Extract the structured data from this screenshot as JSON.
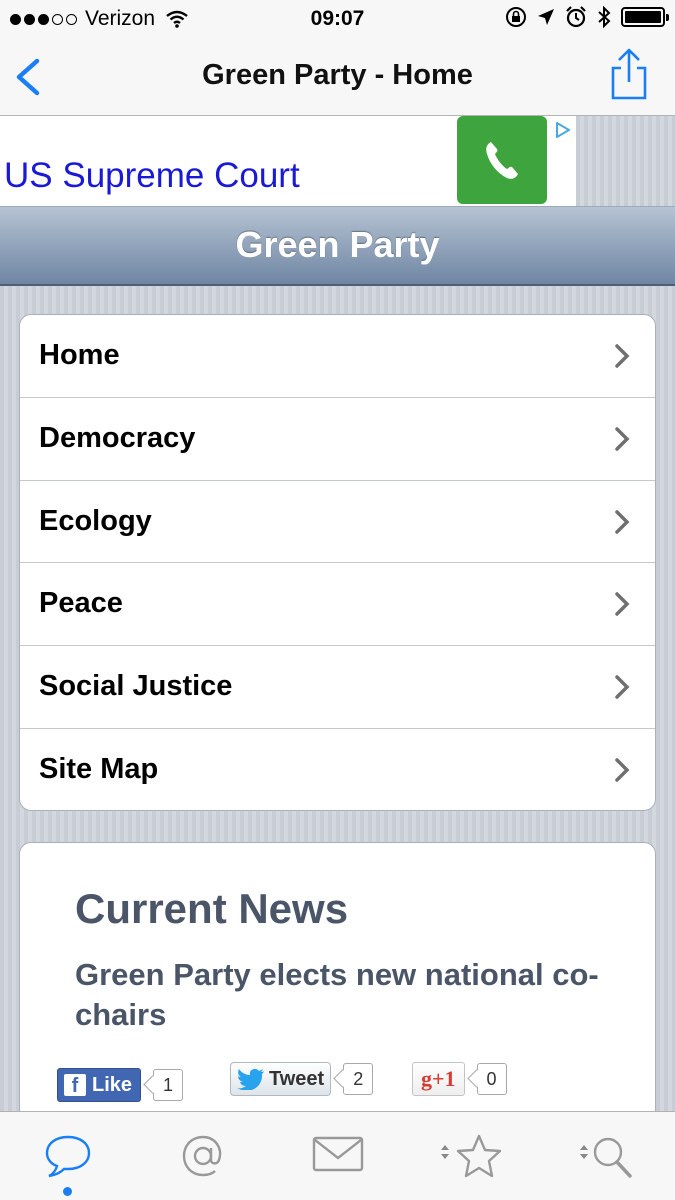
{
  "status_bar": {
    "carrier": "Verizon",
    "time": "09:07",
    "battery_percent": 100
  },
  "nav": {
    "title": "Green Party - Home"
  },
  "ad": {
    "text": "US Supreme Court"
  },
  "header": {
    "title": "Green Party"
  },
  "menu": {
    "items": [
      {
        "label": "Home"
      },
      {
        "label": "Democracy"
      },
      {
        "label": "Ecology"
      },
      {
        "label": "Peace"
      },
      {
        "label": "Social Justice"
      },
      {
        "label": "Site Map"
      }
    ]
  },
  "news": {
    "heading": "Current News",
    "headline": "Green Party elects new national co-chairs"
  },
  "social": {
    "like_label": "Like",
    "like_count": "1",
    "tweet_label": "Tweet",
    "tweet_count": "2",
    "gplus_label": "g+1",
    "gplus_count": "0"
  },
  "tabs": [
    "chat-icon",
    "at-icon",
    "mail-icon",
    "star-sort-icon",
    "search-sort-icon"
  ],
  "colors": {
    "accent": "#1a7ff5",
    "ad_link": "#1a1ad6",
    "call_green": "#3ea43e",
    "news_text": "#4a5568"
  }
}
